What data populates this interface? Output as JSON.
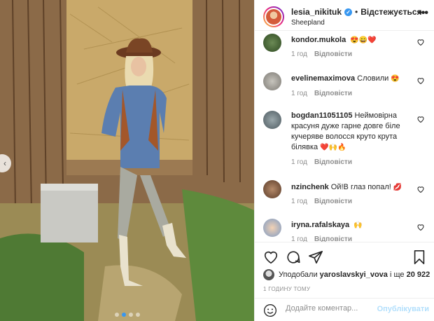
{
  "post": {
    "username": "lesia_nikituk",
    "separator": "•",
    "follow_label": "Відстежується",
    "location": "Sheepland",
    "more_icon": "more-horizontal-icon"
  },
  "comments": [
    {
      "username": "kondor.mukola",
      "text": "",
      "emoji": "😍😄❤️",
      "time": "1 год",
      "reply": "Відповісти"
    },
    {
      "username": "evelinemaximova",
      "text": "Словили",
      "emoji": "😍",
      "time": "1 год",
      "reply": "Відповісти"
    },
    {
      "username": "bogdan11051105",
      "text": "Неймовірна красуня дуже гарне довге біле кучеряве волосся круто крута білявка",
      "emoji": "❤️🙌🔥",
      "time": "1 год",
      "reply": "Відповісти"
    },
    {
      "username": "nzinchenk",
      "text": "Ой!В глаз попал!",
      "emoji": "💋",
      "time": "1 год",
      "reply": "Відповісти"
    },
    {
      "username": "iryna.rafalskaya",
      "text": "",
      "emoji": "🙌",
      "time": "1 год",
      "reply": "Відповісти"
    }
  ],
  "actions": {
    "icons": [
      "heart-icon",
      "comment-icon",
      "share-icon",
      "bookmark-icon"
    ]
  },
  "likes": {
    "prefix": "Уподобали",
    "user": "yaroslavskyi_vova",
    "and_label": "і ще",
    "count": "20 922"
  },
  "timestamp": "1 ГОДИНУ ТОМУ",
  "add_comment": {
    "placeholder": "Додайте коментар...",
    "post_label": "Опублікувати"
  },
  "carousel": {
    "dots": 4,
    "active_index": 1
  },
  "colors": {
    "accent": "#3897f0",
    "post_disabled": "#b2dffc",
    "muted": "#8e8e8e",
    "heart_red": "#ed4956"
  }
}
